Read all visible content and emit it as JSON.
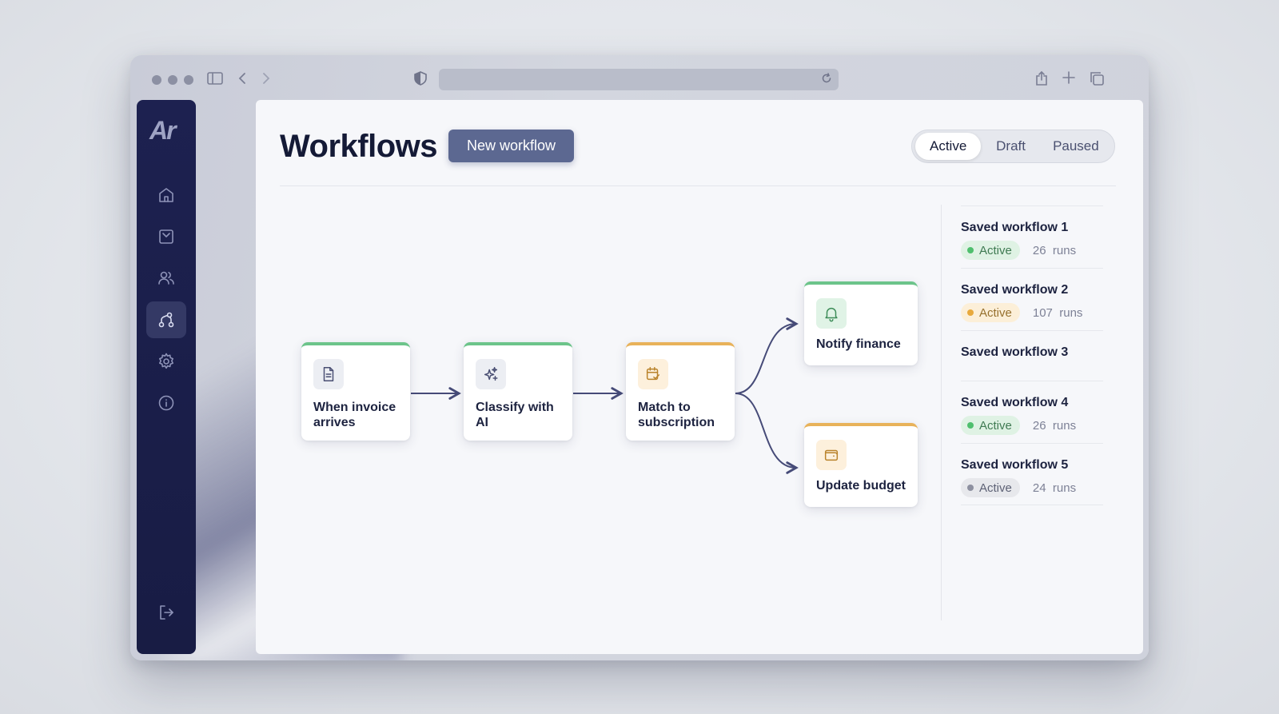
{
  "browser": {
    "url": ""
  },
  "app": {
    "logo": "Ar"
  },
  "sidebar": {
    "items": [
      {
        "name": "home",
        "icon": "home-icon",
        "active": false
      },
      {
        "name": "inbox",
        "icon": "inbox-icon",
        "active": false
      },
      {
        "name": "users",
        "icon": "users-icon",
        "active": false
      },
      {
        "name": "workflows",
        "icon": "workflow-icon",
        "active": true
      },
      {
        "name": "settings",
        "icon": "gear-icon",
        "active": false
      },
      {
        "name": "info",
        "icon": "info-icon",
        "active": false
      }
    ],
    "logout_icon": "logout-icon"
  },
  "header": {
    "title": "Workflows",
    "new_button": "New workflow",
    "filters": [
      "Active",
      "Draft",
      "Paused"
    ],
    "selected_filter": "Active"
  },
  "flow": {
    "nodes": [
      {
        "label": "When invoice arrives",
        "icon": "document-icon",
        "status_color": "#6cc48a"
      },
      {
        "label": "Classify with AI",
        "icon": "sparkle-icon",
        "status_color": "#6cc48a"
      },
      {
        "label": "Match to subscription",
        "icon": "calendar-check-icon",
        "status_color": "#e8b25a"
      },
      {
        "label": "Notify finance",
        "icon": "bell-icon",
        "status_color": "#6cc48a"
      },
      {
        "label": "Update budget",
        "icon": "wallet-icon",
        "status_color": "#e8b25a"
      }
    ]
  },
  "saved_workflows": [
    {
      "title": "Saved workflow 1",
      "status": "Active",
      "status_color": "green",
      "runs": "26",
      "runs_suffix": "runs"
    },
    {
      "title": "Saved workflow 2",
      "status": "Active",
      "status_color": "amber",
      "runs": "107",
      "runs_suffix": "runs"
    },
    {
      "title": "Saved workflow 3",
      "status": "",
      "status_color": "",
      "runs": "",
      "runs_suffix": ""
    },
    {
      "title": "Saved workflow 4",
      "status": "Active",
      "status_color": "green",
      "runs": "26",
      "runs_suffix": "runs"
    },
    {
      "title": "Saved workflow 5",
      "status": "Active",
      "status_color": "gray",
      "runs": "24",
      "runs_suffix": "runs"
    }
  ],
  "colors": {
    "accent": "#5c6891",
    "sidebar": "#1d2150",
    "green": "#6cc48a",
    "amber": "#e8b25a"
  }
}
